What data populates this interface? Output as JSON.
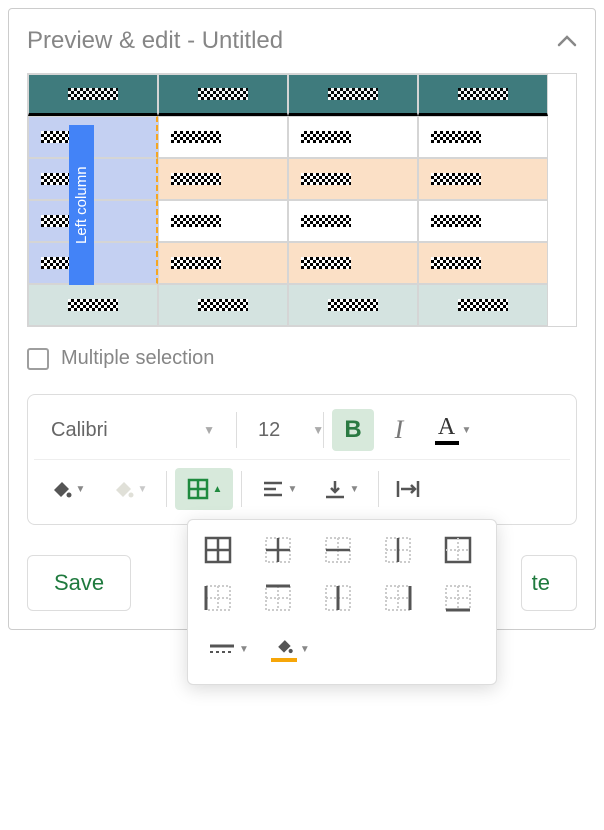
{
  "header": {
    "title": "Preview & edit - Untitled"
  },
  "preview": {
    "leftColumnLabel": "Left column"
  },
  "multipleSelection": {
    "label": "Multiple selection",
    "checked": false
  },
  "toolbar": {
    "font": "Calibri",
    "fontSize": "12",
    "bold": "B",
    "italic": "I",
    "fontColor": "A"
  },
  "actions": {
    "save": "Save",
    "partialRight": "te"
  },
  "borderPopup": {
    "options": [
      "all",
      "inner",
      "horizontal",
      "vertical",
      "outer",
      "left",
      "top",
      "right",
      "center-v",
      "bottom"
    ]
  }
}
